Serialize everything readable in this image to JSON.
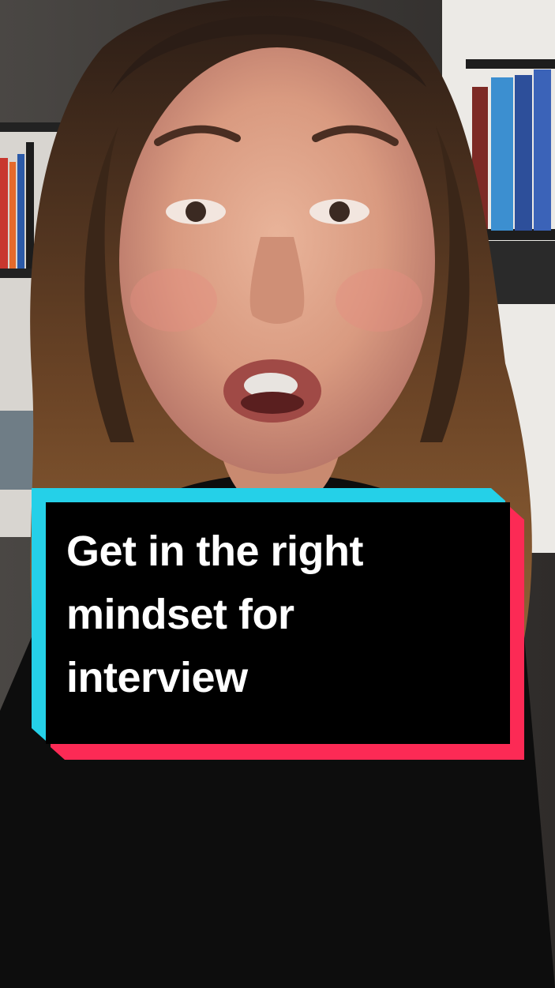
{
  "caption": {
    "line1": "Get in the right",
    "line2": "mindset for",
    "line3": "interview"
  },
  "colors": {
    "caption_background": "#000000",
    "caption_text": "#ffffff",
    "accent_cyan": "#25d0e8",
    "accent_red": "#fc2a55"
  },
  "scene": {
    "description_icon": "person-speaking-photo"
  }
}
